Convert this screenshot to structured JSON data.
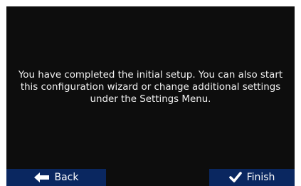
{
  "message": "You have completed the initial setup. You can also start this configuration wizard or change additional settings under the Settings Menu.",
  "buttons": {
    "back_label": "Back",
    "finish_label": "Finish"
  },
  "icons": {
    "back": "arrow-left-icon",
    "finish": "checkmark-icon"
  },
  "colors": {
    "background": "#0d0d0d",
    "button": "#0a2760",
    "text": "#f2f2f2"
  }
}
